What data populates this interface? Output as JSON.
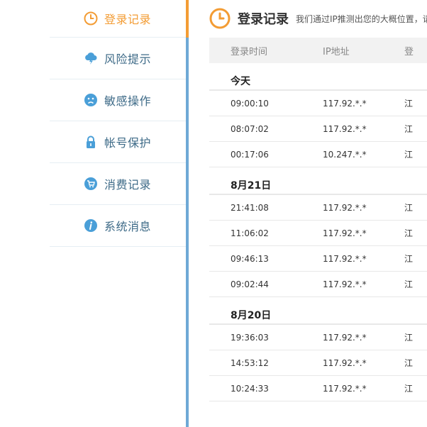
{
  "sidebar": {
    "items": [
      {
        "label": "登录记录",
        "icon": "clock-icon",
        "active": true
      },
      {
        "label": "风险提示",
        "icon": "storm-cloud-icon",
        "active": false
      },
      {
        "label": "敏感操作",
        "icon": "sad-face-icon",
        "active": false
      },
      {
        "label": "帐号保护",
        "icon": "lock-icon",
        "active": false
      },
      {
        "label": "消费记录",
        "icon": "cart-icon",
        "active": false
      },
      {
        "label": "系统消息",
        "icon": "info-icon",
        "active": false
      }
    ]
  },
  "header": {
    "title": "登录记录",
    "description": "我们通过IP推测出您的大概位置，请"
  },
  "table": {
    "columns": [
      "登录时间",
      "IP地址",
      "登"
    ],
    "groups": [
      {
        "title": "今天",
        "rows": [
          {
            "time": "09:00:10",
            "ip": "117.92.*.*",
            "extra": "江"
          },
          {
            "time": "08:07:02",
            "ip": "117.92.*.*",
            "extra": "江"
          },
          {
            "time": "00:17:06",
            "ip": "10.247.*.*",
            "extra": "江"
          }
        ]
      },
      {
        "title": "8月21日",
        "rows": [
          {
            "time": "21:41:08",
            "ip": "117.92.*.*",
            "extra": "江"
          },
          {
            "time": "11:06:02",
            "ip": "117.92.*.*",
            "extra": "江"
          },
          {
            "time": "09:46:13",
            "ip": "117.92.*.*",
            "extra": "江"
          },
          {
            "time": "09:02:44",
            "ip": "117.92.*.*",
            "extra": "江"
          }
        ]
      },
      {
        "title": "8月20日",
        "rows": [
          {
            "time": "19:36:03",
            "ip": "117.92.*.*",
            "extra": "江"
          },
          {
            "time": "14:53:12",
            "ip": "117.92.*.*",
            "extra": "江"
          },
          {
            "time": "10:24:33",
            "ip": "117.92.*.*",
            "extra": "江"
          }
        ]
      }
    ]
  },
  "colors": {
    "accent": "#f39c34",
    "sidebar_text": "#3d6a87",
    "divider": "#6fa9d6",
    "icon_blue": "#4a9fd8"
  }
}
